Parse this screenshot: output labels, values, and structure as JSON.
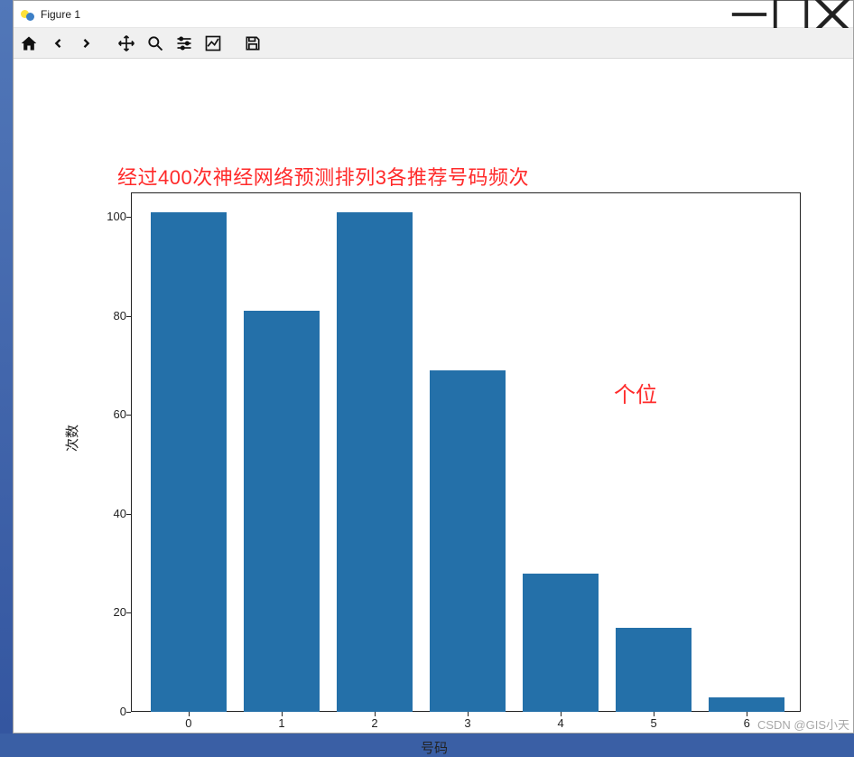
{
  "window": {
    "title": "Figure 1"
  },
  "toolbar": {
    "home": "Home",
    "back": "Back",
    "forward": "Forward",
    "pan": "Pan",
    "zoom": "Zoom",
    "subplots": "Configure subplots",
    "axes": "Edit axes",
    "save": "Save"
  },
  "chart_data": {
    "type": "bar",
    "title": "经过400次神经网络预测排列3各推荐号码频次",
    "annotation": "个位",
    "categories": [
      "0",
      "1",
      "2",
      "3",
      "4",
      "5",
      "6"
    ],
    "values": [
      101,
      81,
      101,
      69,
      28,
      17,
      3
    ],
    "xlabel": "号码",
    "ylabel": "次数",
    "ylim": [
      0,
      105
    ],
    "yticks": [
      0,
      20,
      40,
      60,
      80,
      100
    ],
    "xticks": [
      "0",
      "1",
      "2",
      "3",
      "4",
      "5",
      "6"
    ]
  },
  "watermark": "CSDN @GIS小天"
}
